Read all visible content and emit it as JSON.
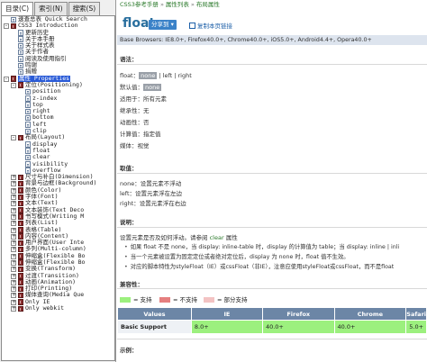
{
  "tabs": [
    "目录(C)",
    "索引(N)",
    "搜索(S)"
  ],
  "tree": [
    {
      "label": "速查总表 Quick Search",
      "level": 0,
      "icon": "page"
    },
    {
      "label": "CSS3 Introduction",
      "level": 0,
      "icon": "book",
      "expand": "-"
    },
    {
      "label": "更新历史",
      "level": 1,
      "icon": "page"
    },
    {
      "label": "关于本手册",
      "level": 1,
      "icon": "page"
    },
    {
      "label": "关于样式表",
      "level": 1,
      "icon": "page"
    },
    {
      "label": "关于作者",
      "level": 1,
      "icon": "page"
    },
    {
      "label": "阅读及使用指引",
      "level": 1,
      "icon": "page"
    },
    {
      "label": "鸣谢",
      "level": 1,
      "icon": "page"
    },
    {
      "label": "捐赠",
      "level": 1,
      "icon": "page"
    },
    {
      "label": "属性 Properties",
      "level": 0,
      "icon": "book",
      "expand": "-",
      "selected": true
    },
    {
      "label": "定位(Positioning)",
      "level": 1,
      "icon": "book",
      "expand": "-"
    },
    {
      "label": "position",
      "level": 2,
      "icon": "page"
    },
    {
      "label": "z-index",
      "level": 2,
      "icon": "page"
    },
    {
      "label": "top",
      "level": 2,
      "icon": "page"
    },
    {
      "label": "right",
      "level": 2,
      "icon": "page"
    },
    {
      "label": "bottom",
      "level": 2,
      "icon": "page"
    },
    {
      "label": "left",
      "level": 2,
      "icon": "page"
    },
    {
      "label": "clip",
      "level": 2,
      "icon": "page"
    },
    {
      "label": "布局(Layout)",
      "level": 1,
      "icon": "book",
      "expand": "-"
    },
    {
      "label": "display",
      "level": 2,
      "icon": "page"
    },
    {
      "label": "float",
      "level": 2,
      "icon": "page"
    },
    {
      "label": "clear",
      "level": 2,
      "icon": "page"
    },
    {
      "label": "visibility",
      "level": 2,
      "icon": "page"
    },
    {
      "label": "overflow",
      "level": 2,
      "icon": "page"
    },
    {
      "label": "尺寸与补白(Dimension)",
      "level": 1,
      "icon": "book",
      "expand": "+"
    },
    {
      "label": "背景与边框(Background)",
      "level": 1,
      "icon": "book",
      "expand": "+"
    },
    {
      "label": "颜色(Color)",
      "level": 1,
      "icon": "book",
      "expand": "+"
    },
    {
      "label": "字体(Font)",
      "level": 1,
      "icon": "book",
      "expand": "+"
    },
    {
      "label": "文本(Text)",
      "level": 1,
      "icon": "book",
      "expand": "+"
    },
    {
      "label": "文本装饰(Text Deco",
      "level": 1,
      "icon": "book",
      "expand": "+"
    },
    {
      "label": "书写模式(Writing M",
      "level": 1,
      "icon": "book",
      "expand": "+"
    },
    {
      "label": "列表(List)",
      "level": 1,
      "icon": "book",
      "expand": "+"
    },
    {
      "label": "表格(Table)",
      "level": 1,
      "icon": "book",
      "expand": "+"
    },
    {
      "label": "内容(Content)",
      "level": 1,
      "icon": "book",
      "expand": "+"
    },
    {
      "label": "用户界面(User Inte",
      "level": 1,
      "icon": "book",
      "expand": "+"
    },
    {
      "label": "多列(Multi-column)",
      "level": 1,
      "icon": "book",
      "expand": "+"
    },
    {
      "label": "伸缩盒(Flexible Bo",
      "level": 1,
      "icon": "book",
      "expand": "+"
    },
    {
      "label": "伸缩盒(Flexible Bo",
      "level": 1,
      "icon": "book",
      "expand": "+"
    },
    {
      "label": "变换(Transform)",
      "level": 1,
      "icon": "book",
      "expand": "+"
    },
    {
      "label": "过渡(Transition)",
      "level": 1,
      "icon": "book",
      "expand": "+"
    },
    {
      "label": "动画(Animation)",
      "level": 1,
      "icon": "book",
      "expand": "+"
    },
    {
      "label": "打印(Printing)",
      "level": 1,
      "icon": "book",
      "expand": "+"
    },
    {
      "label": "媒体查询(Media Que",
      "level": 1,
      "icon": "book",
      "expand": "+"
    },
    {
      "label": "Only IE",
      "level": 1,
      "icon": "book",
      "expand": "+"
    },
    {
      "label": "Only webkit",
      "level": 1,
      "icon": "book",
      "expand": "+"
    }
  ],
  "breadcrumb": [
    "CSS3参考手册",
    "属性列表",
    "布局属性"
  ],
  "title": "float",
  "share_label": "分享到",
  "copy_link_label": "复制本页链接",
  "browsers": "Base Browsers: IE8.0+, Firefox40.0+, Chrome40.0+, iOS5.0+, Android4.4+, Opera40.0+",
  "syntax": {
    "heading": "语法：",
    "prop": "float：",
    "opt_none": "none",
    "opt_rest": " | left | right",
    "default_label": "默认值：",
    "default_value": "none",
    "applies": "适用于：所有元素",
    "inherited": "继承性：无",
    "animatable": "动画性：否",
    "computed": "计算值：指定值",
    "media": "媒体：视觉"
  },
  "values": {
    "heading": "取值：",
    "items": [
      "none：设置元素不浮动",
      "left：设置元素浮在左边",
      "right：设置元素浮在右边"
    ]
  },
  "notes": {
    "heading": "说明：",
    "intro_a": "设置元素是否及如何浮动。请参阅 ",
    "intro_kw": "clear",
    "intro_b": " 属性",
    "bullets": [
      "如果 float 不是 none，当 display: inline-table 时，display 的计算值为 table；当 display: inline | inli",
      "当一个元素被设置为固定定位或者绝对定位后，display 为 none 时，float 值不生效。",
      "对应的脚本特性为styleFloat（IE）或cssFloat（非IE），注意应使用styleFloat或cssFloat，而不是float"
    ]
  },
  "compat": {
    "heading": "兼容性：",
    "legend": [
      "= 支持",
      "= 不支持",
      "= 部分支持"
    ],
    "colors": {
      "yes": "#9cf07e",
      "no": "#e57f7f",
      "partial": "#f3c3c3"
    },
    "headers": [
      "Values",
      "IE",
      "Firefox",
      "Chrome",
      "Safari"
    ],
    "rows": [
      [
        "Basic Support",
        "8.0+",
        "40.0+",
        "40.0+",
        "5.0+"
      ]
    ]
  },
  "example_heading": "示例："
}
